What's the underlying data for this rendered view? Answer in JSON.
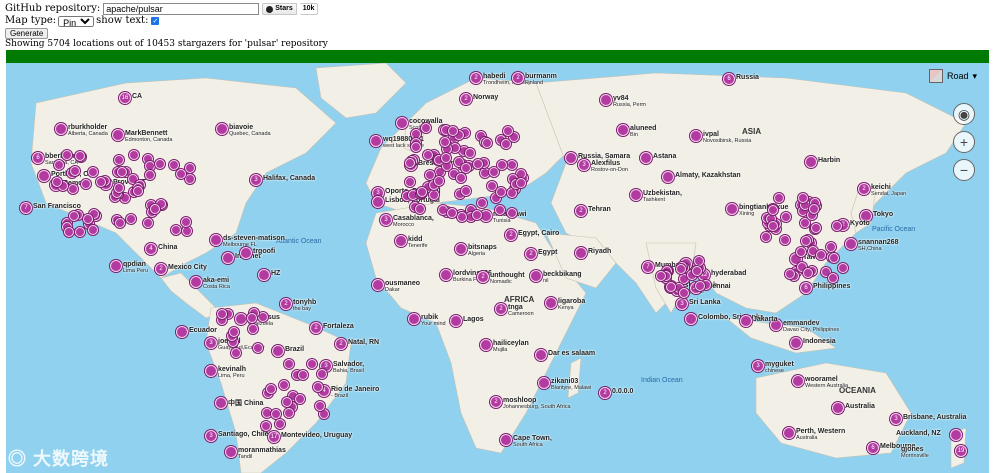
{
  "form": {
    "repo_label": "GitHub repository:",
    "repo_value": "apache/pulsar",
    "stars_label": "Stars",
    "stars_count": "10k",
    "maptype_label": "Map type:",
    "maptype_value": "Pin",
    "showtext_label": "show text:",
    "generate_label": "Generate"
  },
  "status": "Showing 5704 locations out of 10453 stargazers for 'pulsar' repository",
  "progress_fraction": 1.0,
  "map": {
    "road_label": "Road",
    "oceans": [
      "Atlantic Ocean",
      "Pacific Ocean",
      "Indian Ocean"
    ],
    "regions": [
      "ASIA",
      "AFRICA",
      "OCEANIA"
    ],
    "watermark": "大数跨境",
    "pins": [
      {
        "label": "CA",
        "count": "16"
      },
      {
        "label": "rburkholder",
        "sub": "Alberta, Canada"
      },
      {
        "label": "MarkBennett",
        "sub": "Edmonton, Canada"
      },
      {
        "label": "biavoie",
        "sub": "Quebec, Canada"
      },
      {
        "label": "bberliner",
        "sub": "Saratoga, CA"
      },
      {
        "label": "Portland, OR"
      },
      {
        "label": "Provo, UT"
      },
      {
        "label": "Remote"
      },
      {
        "label": "San Francisco"
      },
      {
        "label": "Halifax, Canada"
      },
      {
        "label": "ds-steven-matison",
        "sub": "Melbourne FL"
      },
      {
        "label": "China"
      },
      {
        "label": "qpdian",
        "sub": "Lima Peru"
      },
      {
        "label": "Mexico City"
      },
      {
        "label": "Internet"
      },
      {
        "label": "trgoofi"
      },
      {
        "label": "HZ"
      },
      {
        "label": "aka-emi",
        "sub": "Costa Rica"
      },
      {
        "label": "tonyhb",
        "sub": "the bay"
      },
      {
        "label": "devljesus",
        "sub": "venezuela"
      },
      {
        "label": "Ecuador"
      },
      {
        "label": "joelerll",
        "sub": "Guayaquil,Ecuador"
      },
      {
        "label": "Fortaleza"
      },
      {
        "label": "Natal, RN"
      },
      {
        "label": "Brazil"
      },
      {
        "label": "Salvador,",
        "sub": "Bahia, Brasil"
      },
      {
        "label": "kevinalh",
        "sub": "Lima, Peru"
      },
      {
        "label": "中国 China"
      },
      {
        "label": "Rio de Janeiro",
        "sub": "- Brazil"
      },
      {
        "label": "Santiago, Chile"
      },
      {
        "label": "Montevideo, Uruguay"
      },
      {
        "label": "moranmathias",
        "sub": "Tandil"
      },
      {
        "label": "habedi",
        "sub": "Trondheim, Norway"
      },
      {
        "label": "burmanm",
        "sub": "Finland"
      },
      {
        "label": "Norway"
      },
      {
        "label": "cocowalla",
        "sub": "Scotland"
      },
      {
        "label": "wq19880601",
        "sub": "west lack square"
      },
      {
        "label": "Brest, France"
      },
      {
        "label": "Oporto, Portugal"
      },
      {
        "label": "Lisboa, Portugal"
      },
      {
        "label": "Casablanca,",
        "sub": "Morocco"
      },
      {
        "label": "kidd",
        "sub": "Tenerife"
      },
      {
        "label": "bitsnaps",
        "sub": "Algeria"
      },
      {
        "label": "msaadawi",
        "sub": "Tunisia"
      },
      {
        "label": "Egypt, Cairo"
      },
      {
        "label": "Egypt"
      },
      {
        "label": "ousmaneo",
        "sub": "Dakar"
      },
      {
        "label": "lordvins226",
        "sub": "Burkina Faso"
      },
      {
        "label": "unthought",
        "sub": "Nomadic"
      },
      {
        "label": "beckbikang",
        "sub": "nil"
      },
      {
        "label": "rubik",
        "sub": "Your mind"
      },
      {
        "label": "Lagos"
      },
      {
        "label": "tnga",
        "sub": "Cameroon"
      },
      {
        "label": "ligaroba",
        "sub": "Kenya"
      },
      {
        "label": "hailiceylan",
        "sub": "Mujila"
      },
      {
        "label": "Dar es salaam"
      },
      {
        "label": "zikani03",
        "sub": "Blantyre, Malawi"
      },
      {
        "label": "moshloop",
        "sub": "Johannesburg, South Africa"
      },
      {
        "label": "Cape Town,",
        "sub": "South Africa"
      },
      {
        "label": "0.0.0.0"
      },
      {
        "label": "yv84",
        "sub": "Russia, Perm"
      },
      {
        "label": "Russia"
      },
      {
        "label": "aluneed",
        "sub": "Bin"
      },
      {
        "label": "ivpal",
        "sub": "Novosibirsk, Russia"
      },
      {
        "label": "Russia, Samara"
      },
      {
        "label": "Alexfilus",
        "sub": "Rostov-on-Don"
      },
      {
        "label": "Astana"
      },
      {
        "label": "Almaty, Kazakhstan"
      },
      {
        "label": "Uzbekistan,",
        "sub": "Tashkent"
      },
      {
        "label": "Tehran"
      },
      {
        "label": "Riyadh"
      },
      {
        "label": "Mumbai,India"
      },
      {
        "label": "IN"
      },
      {
        "label": "hyderabad"
      },
      {
        "label": "arshinalbab",
        "sub": "Mangalore"
      },
      {
        "label": "Chennai"
      },
      {
        "label": "Sri Lanka"
      },
      {
        "label": "Colombo, Sri Lanka."
      },
      {
        "label": "bingtianbaixue",
        "sub": "Xining"
      },
      {
        "label": "Harbin"
      },
      {
        "label": "keichi",
        "sub": "Sendai, Japan"
      },
      {
        "label": "Tokyo"
      },
      {
        "label": "Kyoto"
      },
      {
        "label": "snannan268",
        "sub": "SH,China"
      },
      {
        "label": "Taiwan"
      },
      {
        "label": "Philippines"
      },
      {
        "label": "emmandev",
        "sub": "Davao City, Philippines"
      },
      {
        "label": "Jakarta"
      },
      {
        "label": "Indonesia"
      },
      {
        "label": "myguket",
        "sub": "chinese"
      },
      {
        "label": "wooramel",
        "sub": "Western Australia"
      },
      {
        "label": "Australia"
      },
      {
        "label": "Perth, Western",
        "sub": "Australia"
      },
      {
        "label": "Brisbane, Australia"
      },
      {
        "label": "Auckland, NZ"
      },
      {
        "label": "Melbourne"
      },
      {
        "label": "gjones",
        "sub": "Morrinsville"
      }
    ]
  }
}
